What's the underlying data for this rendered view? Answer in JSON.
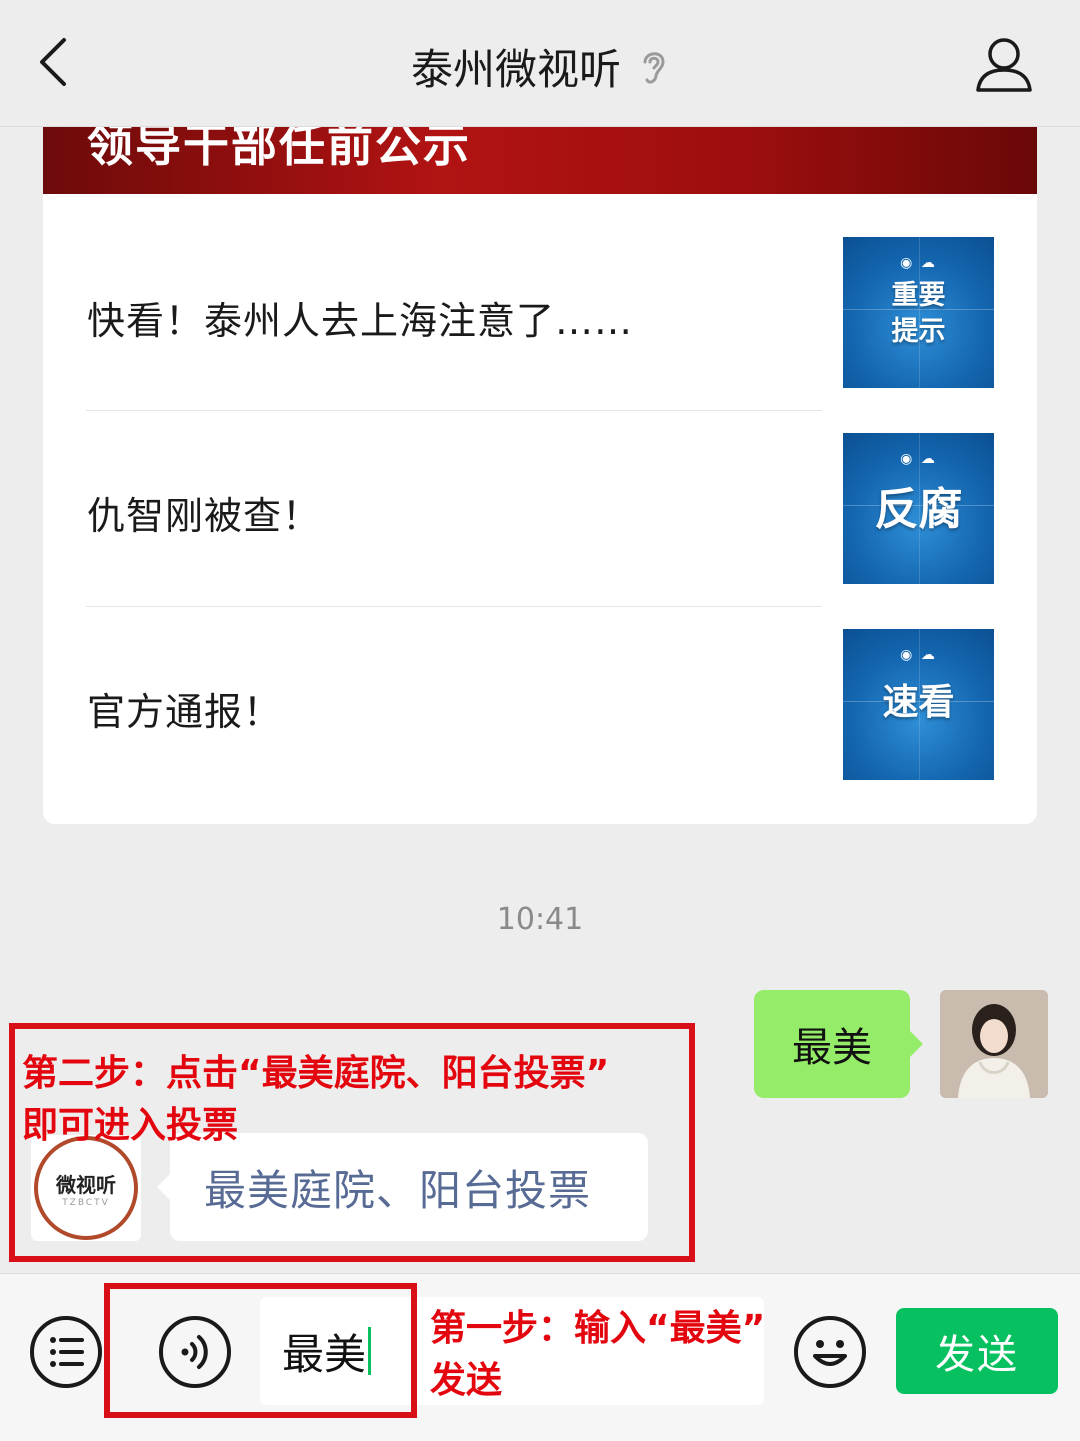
{
  "header": {
    "title": "泰州微视听",
    "back_icon": "chevron-left-icon",
    "ear_icon": "ear-icon",
    "profile_icon": "person-icon"
  },
  "news_card": {
    "banner_text": "领导干部任前公示",
    "items": [
      {
        "title": "快看！泰州人去上海注意了……",
        "thumb_text": [
          "重要",
          "提示"
        ]
      },
      {
        "title": "仇智刚被查！",
        "thumb_text": [
          "反腐"
        ]
      },
      {
        "title": "官方通报！",
        "thumb_text": [
          "速看"
        ]
      }
    ]
  },
  "chat": {
    "timestamp": "10:41",
    "outgoing_message": "最美",
    "incoming_message": "最美庭院、阳台投票",
    "bot_logo_text": "微视听",
    "bot_logo_sub": "TZBCTV"
  },
  "annotations": {
    "step2_line1": "第二步：点击“最美庭院、阳台投票”",
    "step2_line2": "即可进入投票",
    "step1_line1": "第一步：输入“最美”",
    "step1_line2": "发送",
    "highlight_color": "#d80f16"
  },
  "input_bar": {
    "menu_icon": "list-icon",
    "voice_icon": "voice-icon",
    "input_value": "最美",
    "emoji_icon": "smiley-icon",
    "send_label": "发送",
    "send_color": "#07c160"
  }
}
